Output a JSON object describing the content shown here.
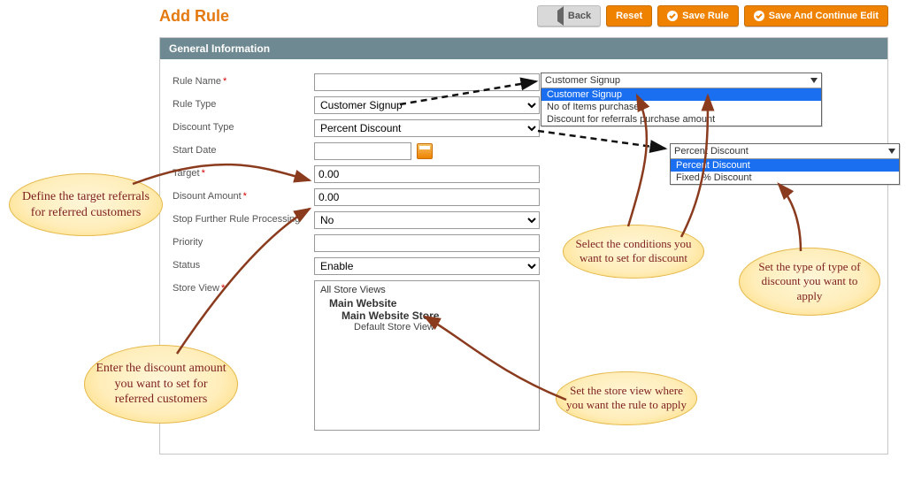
{
  "header": {
    "title": "Add Rule",
    "back": "Back",
    "reset": "Reset",
    "save": "Save Rule",
    "save_continue": "Save And Continue Edit"
  },
  "section_title": "General Information",
  "labels": {
    "rule_name": "Rule Name",
    "rule_type": "Rule Type",
    "discount_type": "Discount Type",
    "start_date": "Start Date",
    "target": "Target",
    "discount_amount": "Disount Amount",
    "stop_further": "Stop Further Rule Processing",
    "priority": "Priority",
    "status": "Status",
    "store_view": "Store View"
  },
  "values": {
    "rule_name": "",
    "rule_type": "Customer Signup",
    "discount_type": "Percent Discount",
    "start_date": "",
    "target": "0.00",
    "discount_amount": "0.00",
    "stop_further": "No",
    "priority": "",
    "status": "Enable"
  },
  "store_view_list": {
    "lv1": "All Store Views",
    "lv2": "Main Website",
    "lv3": "Main Website Store",
    "lv4": "Default Store View"
  },
  "dropdowns": {
    "rule_type": {
      "header": "Customer Signup",
      "options": [
        "Customer Signup",
        "No of Items purchased",
        "Discount for referrals purchase amount"
      ],
      "selected": 0
    },
    "discount_type": {
      "header": "Percent Discount",
      "options": [
        "Percent Discount",
        "Fixed % Discount"
      ],
      "selected": 0
    }
  },
  "callouts": {
    "target": "Define the target referrals for referred customers",
    "amount": "Enter the discount amount you want to set for referred customers",
    "conditions": "Select the conditions you want to set for discount",
    "disc_type": "Set the type of type of discount you want to apply",
    "store": "Set the store view where you want the rule to apply"
  }
}
